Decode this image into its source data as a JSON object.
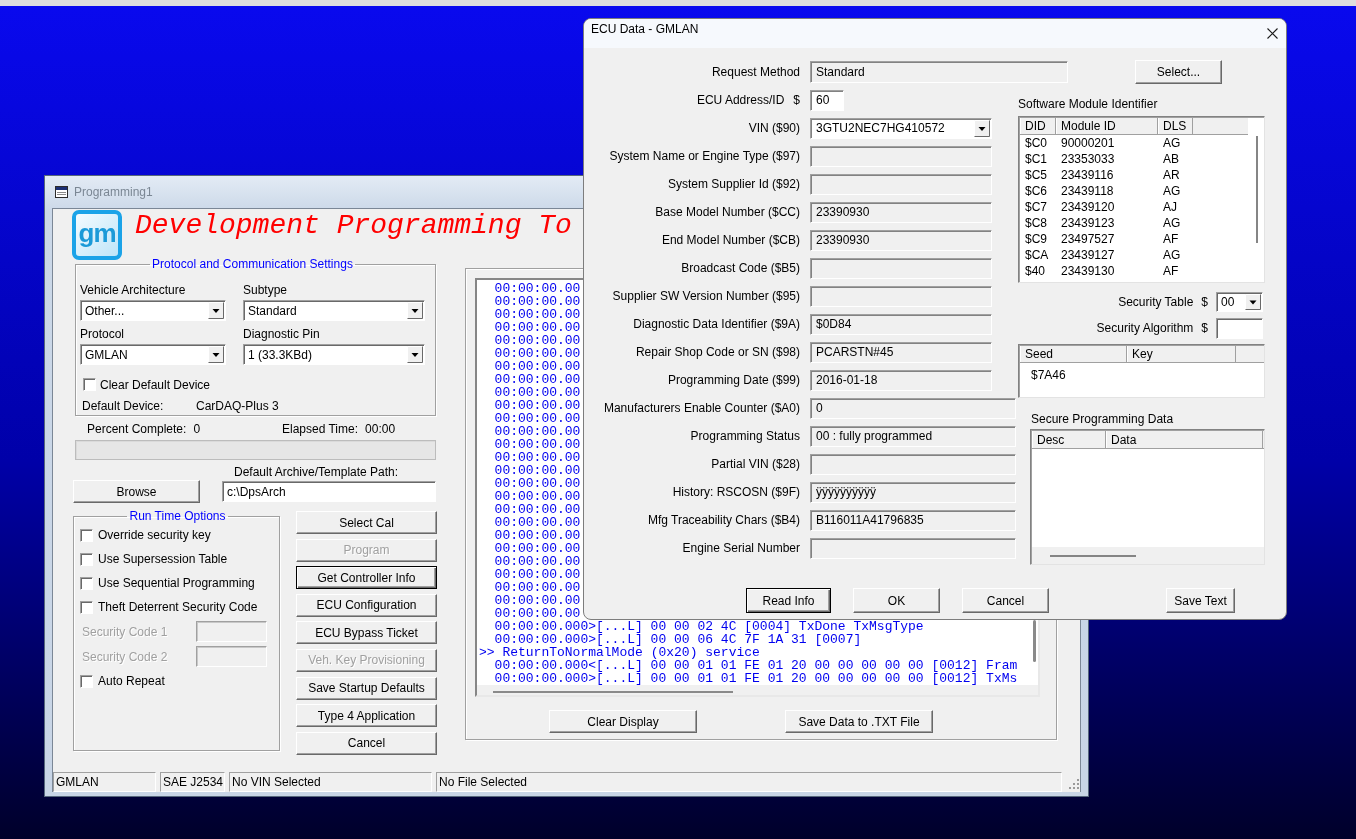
{
  "programming_window": {
    "title": "Programming1",
    "active": false,
    "logo": "gm",
    "heading": "Development Programming To",
    "protocol_settings": {
      "title": "Protocol and Communication Settings",
      "dropdowns": [
        {
          "label": "Vehicle Architecture",
          "value": "Other..."
        },
        {
          "label": "Subtype",
          "value": "Standard"
        },
        {
          "label": "Protocol",
          "value": "GMLAN"
        },
        {
          "label": "Diagnostic Pin",
          "value": "1 (33.3KBd)"
        }
      ],
      "clear_default_device": {
        "label": "Clear Default Device",
        "checked": false
      },
      "default_device": {
        "label": "Default Device:",
        "value": "CarDAQ-Plus 3"
      }
    },
    "progress_info": [
      {
        "label": "Percent Complete:",
        "value": "0"
      },
      {
        "label": "Elapsed Time:",
        "value": "00:00"
      }
    ],
    "progress": {
      "level": 0
    },
    "archive_path": {
      "label": "Default Archive/Template Path:",
      "value": "c:\\DpsArch"
    },
    "browse_button": "Browse",
    "run_time_options": {
      "title": "Run Time Options",
      "items": [
        {
          "kind": "checkbox",
          "label": "Override security key",
          "checked": false
        },
        {
          "kind": "checkbox",
          "label": "Use Supersession Table",
          "checked": false
        },
        {
          "kind": "checkbox",
          "label": "Use Sequential Programming",
          "checked": false
        },
        {
          "kind": "checkbox",
          "label": "Theft Deterrent Security Code",
          "checked": false
        },
        {
          "kind": "code_field",
          "label": "Security Code 1",
          "disabled": true
        },
        {
          "kind": "code_field",
          "label": "Security Code 2",
          "disabled": true
        },
        {
          "kind": "checkbox",
          "label": "Auto Repeat",
          "checked": false
        }
      ]
    },
    "actions": [
      {
        "label": "Select Cal",
        "disabled": false,
        "default": false
      },
      {
        "label": "Program",
        "disabled": true,
        "default": false
      },
      {
        "label": "Get Controller Info",
        "disabled": false,
        "default": true
      },
      {
        "label": "ECU Configuration",
        "disabled": false,
        "default": false
      },
      {
        "label": "ECU Bypass Ticket",
        "disabled": false,
        "default": false
      },
      {
        "label": "Veh. Key Provisioning",
        "disabled": true,
        "default": false
      },
      {
        "label": "Save Startup Defaults",
        "disabled": false,
        "default": false
      },
      {
        "label": "Type 4 Application",
        "disabled": false,
        "default": false
      },
      {
        "label": "Cancel",
        "disabled": false,
        "default": false
      }
    ],
    "log": {
      "lines": [
        {
          "kind": "entry",
          "text": "00:00:00.00"
        },
        {
          "kind": "entry",
          "text": "00:00:00.00"
        },
        {
          "kind": "entry",
          "text": "00:00:00.00"
        },
        {
          "kind": "entry",
          "text": "00:00:00.00"
        },
        {
          "kind": "entry",
          "text": "00:00:00.00"
        },
        {
          "kind": "entry",
          "text": "00:00:00.00"
        },
        {
          "kind": "entry",
          "text": "00:00:00.00"
        },
        {
          "kind": "entry",
          "text": "00:00:00.00"
        },
        {
          "kind": "entry",
          "text": "00:00:00.00"
        },
        {
          "kind": "entry",
          "text": "00:00:00.00"
        },
        {
          "kind": "entry",
          "text": "00:00:00.00"
        },
        {
          "kind": "entry",
          "text": "00:00:00.00"
        },
        {
          "kind": "entry",
          "text": "00:00:00.00"
        },
        {
          "kind": "entry",
          "text": "00:00:00.00"
        },
        {
          "kind": "entry",
          "text": "00:00:00.00"
        },
        {
          "kind": "entry",
          "text": "00:00:00.00"
        },
        {
          "kind": "entry",
          "text": "00:00:00.00"
        },
        {
          "kind": "entry",
          "text": "00:00:00.00"
        },
        {
          "kind": "entry",
          "text": "00:00:00.00"
        },
        {
          "kind": "entry",
          "text": "00:00:00.00"
        },
        {
          "kind": "entry",
          "text": "00:00:00.00"
        },
        {
          "kind": "entry",
          "text": "00:00:00.00"
        },
        {
          "kind": "entry",
          "text": "00:00:00.00"
        },
        {
          "kind": "entry",
          "text": "00:00:00.00"
        },
        {
          "kind": "entry",
          "text": "00:00:00.00"
        },
        {
          "kind": "entry",
          "text": "00:00:00.00"
        },
        {
          "kind": "entry",
          "text": "00:00:00.000>[...L] 00 00 02 4C [0004] TxDone TxMsgType"
        },
        {
          "kind": "entry",
          "text": "00:00:00.000>[...L] 00 00 06 4C 7F 1A 31 [0007]"
        },
        {
          "kind": "service",
          "text": ">> ReturnToNormalMode (0x20) service"
        },
        {
          "kind": "entry",
          "text": "00:00:00.000<[...L] 00 00 01 01 FE 01 20 00 00 00 00 00 [0012] Fram"
        },
        {
          "kind": "entry",
          "text": "00:00:00.000>[...L] 00 00 01 01 FE 01 20 00 00 00 00 00 [0012] TxMs"
        }
      ]
    },
    "log_buttons": [
      "Clear Display",
      "Save Data to .TXT File"
    ],
    "status_bar": [
      "GMLAN",
      "SAE J2534",
      "No VIN Selected",
      "No File Selected"
    ]
  },
  "ecu_data_window": {
    "title": "ECU Data - GMLAN",
    "active": true,
    "request_method": {
      "label": "Request Method",
      "value": "Standard"
    },
    "select_button": "Select...",
    "fields": [
      {
        "kind": "input",
        "label": "ECU Address/ID",
        "prefix": "$",
        "value": "60"
      },
      {
        "kind": "dropdown",
        "label": "VIN ($90)",
        "value": "3GTU2NEC7HG410572"
      },
      {
        "kind": "readonly",
        "label": "System Name or Engine Type ($97)"
      },
      {
        "kind": "readonly",
        "label": "System Supplier Id ($92)"
      },
      {
        "kind": "readonly",
        "label": "Base Model Number ($CC)",
        "value": "23390930"
      },
      {
        "kind": "readonly",
        "label": "End Model Number ($CB)",
        "value": "23390930"
      },
      {
        "kind": "readonly",
        "label": "Broadcast Code ($B5)"
      },
      {
        "kind": "readonly",
        "label": "Supplier SW Version Number ($95)"
      },
      {
        "kind": "readonly",
        "label": "Diagnostic Data Identifier ($9A)",
        "value": "$0D84"
      },
      {
        "kind": "readonly",
        "label": "Repair Shop Code or SN ($98)",
        "value": "PCARSTN#45"
      },
      {
        "kind": "readonly",
        "label": "Programming Date ($99)",
        "value": "2016-01-18"
      },
      {
        "kind": "readonly",
        "label": "Manufacturers Enable Counter ($A0)",
        "value": "0"
      },
      {
        "kind": "readonly",
        "label": "Programming Status",
        "value": "00 : fully programmed"
      },
      {
        "kind": "readonly",
        "label": "Partial VIN ($28)"
      },
      {
        "kind": "readonly",
        "label": "History: RSCOSN ($9F)",
        "value": "ÿÿÿÿÿÿÿÿÿÿ"
      },
      {
        "kind": "readonly",
        "label": "Mfg Traceability Chars ($B4)",
        "value": "B116011A41796835"
      },
      {
        "kind": "readonly",
        "label": "Engine Serial Number"
      }
    ],
    "software_module_identifier": {
      "title": "Software Module Identifier",
      "columns": [
        "DID",
        "Module ID",
        "DLS"
      ],
      "rows": [
        [
          "$C0",
          "90000201",
          "AG"
        ],
        [
          "$C1",
          "23353033",
          "AB"
        ],
        [
          "$C5",
          "23439116",
          "AR"
        ],
        [
          "$C6",
          "23439118",
          "AG"
        ],
        [
          "$C7",
          "23439120",
          "AJ"
        ],
        [
          "$C8",
          "23439123",
          "AG"
        ],
        [
          "$C9",
          "23497527",
          "AF"
        ],
        [
          "$CA",
          "23439127",
          "AG"
        ],
        [
          "$40",
          "23439130",
          "AF"
        ]
      ]
    },
    "security_table": {
      "label": "Security Table",
      "prefix": "$",
      "value": "00"
    },
    "security_algorithm": {
      "label": "Security Algorithm",
      "prefix": "$"
    },
    "seed_key": {
      "columns": [
        "Seed",
        "Key"
      ],
      "rows": [
        [
          "$7A46"
        ]
      ]
    },
    "secure_programming_data": {
      "title": "Secure Programming Data",
      "columns": [
        "Desc",
        "Data"
      ]
    },
    "buttons": [
      {
        "label": "Read Info",
        "default": true
      },
      {
        "label": "OK",
        "default": false
      },
      {
        "label": "Cancel",
        "default": false
      },
      {
        "label": "Save Text",
        "default": false
      }
    ]
  }
}
